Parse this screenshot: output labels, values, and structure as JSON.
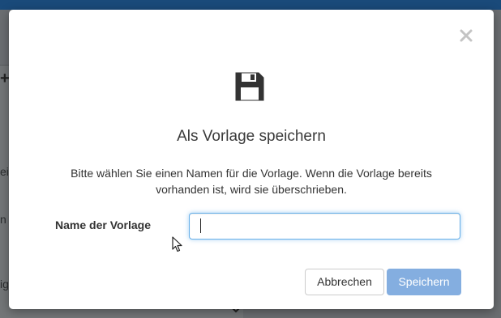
{
  "background": {
    "fragments": [
      "ein",
      "n",
      "ig"
    ]
  },
  "dialog": {
    "title": "Als Vorlage speichern",
    "description": "Bitte wählen Sie einen Namen für die Vorlage. Wenn die Vorlage bereits vorhanden ist, wird sie überschrieben.",
    "field_label": "Name der Vorlage",
    "input_value": "",
    "icon": "floppy-disk-icon",
    "close_icon": "close-icon",
    "buttons": {
      "cancel": "Abbrechen",
      "save": "Speichern"
    }
  },
  "colors": {
    "primary_disabled": "#84aee0",
    "focus_border": "#66afe9",
    "overlay": "#6b6e71"
  }
}
